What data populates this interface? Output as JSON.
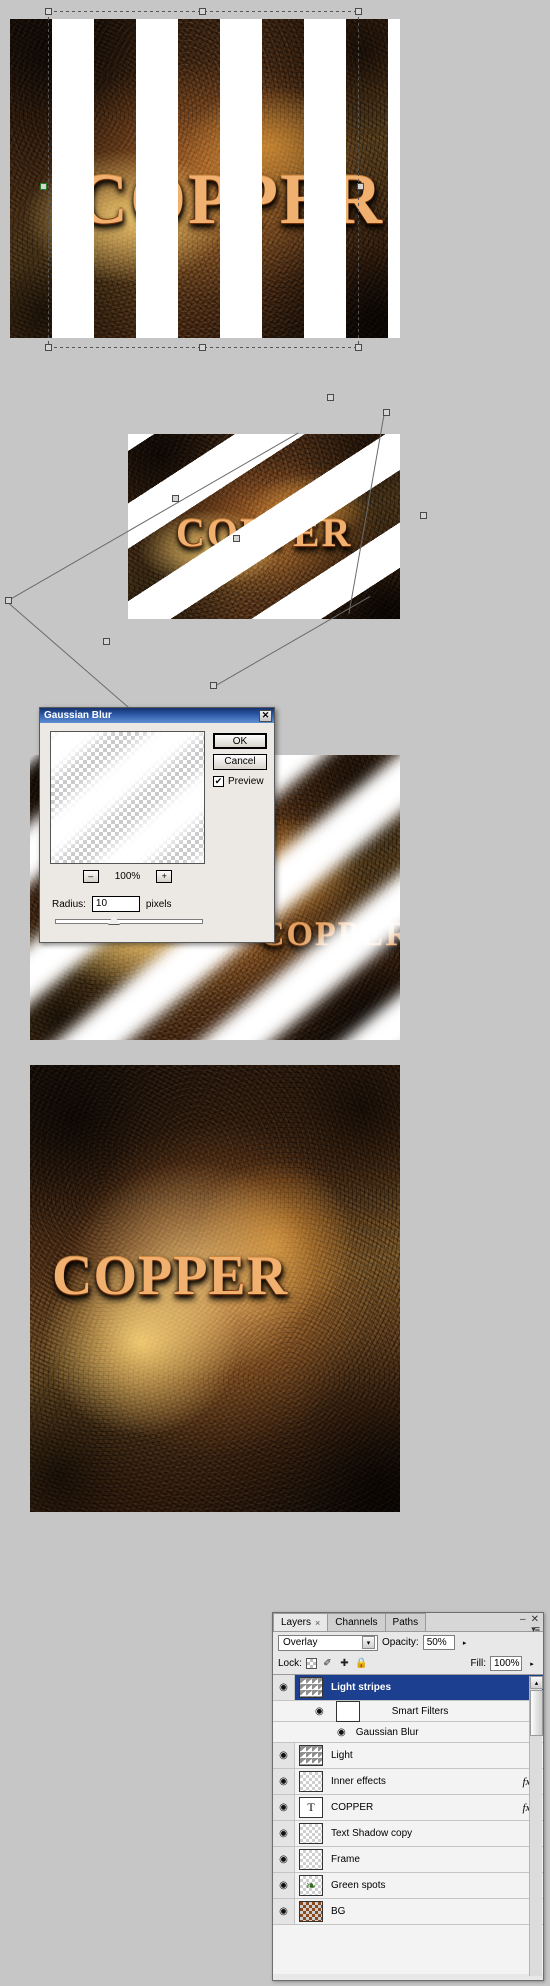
{
  "artwork": {
    "word": "COPPER",
    "panel1_caption": "",
    "panel2_caption": "",
    "panel3_caption": "",
    "panel4_caption": ""
  },
  "dialog": {
    "title": "Gaussian Blur",
    "close_label": "✕",
    "ok_label": "OK",
    "cancel_label": "Cancel",
    "preview_label": "Preview",
    "preview_checked_glyph": "✔",
    "zoom_out_label": "–",
    "zoom_in_label": "+",
    "zoom_level": "100%",
    "radius_label": "Radius:",
    "radius_value": "10",
    "radius_units": "pixels"
  },
  "layers_panel": {
    "tabs": [
      {
        "label": "Layers",
        "close": "×",
        "active": true
      },
      {
        "label": "Channels",
        "close": "",
        "active": false
      },
      {
        "label": "Paths",
        "close": "",
        "active": false
      }
    ],
    "window_minimize": "–",
    "window_close": "✕",
    "panel_menu": "▾≡",
    "blend_mode": "Overlay",
    "blend_arrow": "▾",
    "opacity_label": "Opacity:",
    "opacity_value": "50%",
    "opacity_arrow": "▸",
    "lock_label": "Lock:",
    "lock_icons": [
      "lock-transparent",
      "lock-image",
      "lock-position",
      "lock-all"
    ],
    "lock_brush_glyph": "✐",
    "lock_move_glyph": "✚",
    "lock_all_glyph": "🔒",
    "fill_label": "Fill:",
    "fill_value": "100%",
    "fill_arrow": "▸",
    "eye_glyph": "◉",
    "scroll_up": "▴",
    "scroll_down": "▾",
    "rows": [
      {
        "name": "Light stripes",
        "type": "layer",
        "selected": true,
        "thumb": "stripes",
        "fx": "",
        "arrow": "",
        "mask": true
      },
      {
        "name": "Smart Filters",
        "type": "sub",
        "selected": false,
        "thumb": "mask",
        "fx": "",
        "arrow": ""
      },
      {
        "name": "Gaussian Blur",
        "type": "filter",
        "selected": false,
        "thumb": "",
        "fx": "",
        "arrow": ""
      },
      {
        "name": "Light",
        "type": "layer",
        "selected": false,
        "thumb": "stripes",
        "fx": "",
        "arrow": ""
      },
      {
        "name": "Inner effects",
        "type": "layer",
        "selected": false,
        "thumb": "checker",
        "fx": "fx",
        "arrow": "▾"
      },
      {
        "name": "COPPER",
        "type": "layer",
        "selected": false,
        "thumb": "text",
        "fx": "fx",
        "arrow": "▾"
      },
      {
        "name": "Text Shadow copy",
        "type": "layer",
        "selected": false,
        "thumb": "checker",
        "fx": "",
        "arrow": ""
      },
      {
        "name": "Frame",
        "type": "layer",
        "selected": false,
        "thumb": "checker",
        "fx": "",
        "arrow": ""
      },
      {
        "name": "Green spots",
        "type": "layer",
        "selected": false,
        "thumb": "green",
        "fx": "",
        "arrow": ""
      },
      {
        "name": "BG",
        "type": "layer",
        "selected": false,
        "thumb": "bg",
        "fx": "",
        "arrow": ""
      }
    ],
    "text_thumb_glyph": "T",
    "green_thumb_glyph": "❧",
    "filter_icon": "☲"
  },
  "colors": {
    "canvas_bg": "#c6c6c6",
    "dialog_titlebar": "#2e5ba8",
    "selected_layer": "#1c3f8f",
    "copper_accent": "#c8661f"
  }
}
